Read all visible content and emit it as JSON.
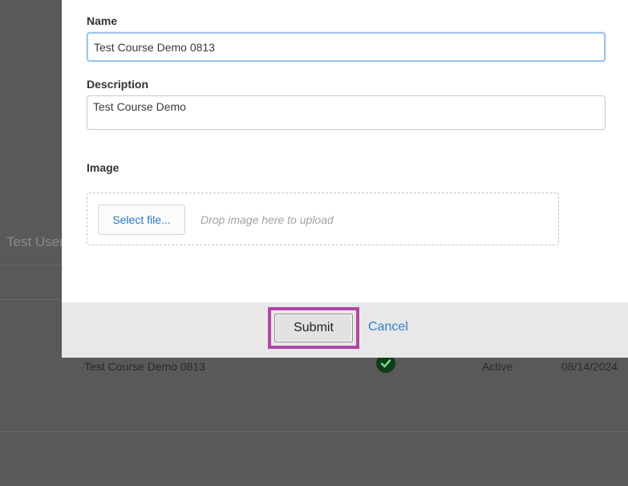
{
  "background": {
    "user_name": "Test User",
    "row": {
      "course_name": "Test Course Demo 0813",
      "status": "Active",
      "date": "08/14/2024"
    }
  },
  "modal": {
    "name_label": "Name",
    "name_value": "Test Course Demo 0813",
    "description_label": "Description",
    "description_value": "Test Course Demo",
    "image_label": "Image",
    "select_file_label": "Select file...",
    "drop_hint": "Drop image here to upload",
    "submit_label": "Submit",
    "cancel_label": "Cancel"
  },
  "icons": {
    "status_check": "check-circle-icon"
  },
  "colors": {
    "highlight": "#b245a6",
    "link": "#2f80c8",
    "check": "#0f3d17"
  }
}
